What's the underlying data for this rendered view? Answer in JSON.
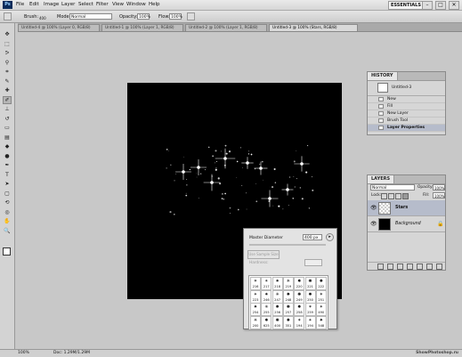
{
  "menubar": {
    "logo": "Ps",
    "items": [
      "File",
      "Edit",
      "Image",
      "Layer",
      "Select",
      "Filter",
      "View",
      "Window",
      "Help"
    ],
    "workspace": "ESSENTIALS ▾",
    "win_buttons": [
      "–",
      "□",
      "✕"
    ]
  },
  "options": {
    "brush_label": "Brush:",
    "brush_size": "400",
    "mode_label": "Mode:",
    "mode_value": "Normal",
    "opacity_label": "Opacity:",
    "opacity_value": "100%",
    "flow_label": "Flow:",
    "flow_value": "100%"
  },
  "tabs": [
    {
      "label": "Untitled-4 @ 100% (Layer 0, RGB/8)"
    },
    {
      "label": "Untitled-1 @ 100% (Layer 1, RGB/8)"
    },
    {
      "label": "Untitled-2 @ 100% (Layer 1, RGB/8)"
    },
    {
      "label": "Untitled-3 @ 100% (Stars, RGB/8)"
    }
  ],
  "tools": [
    {
      "name": "move-tool-icon",
      "glyph": "✥"
    },
    {
      "name": "marquee-tool-icon",
      "glyph": "⬚"
    },
    {
      "name": "lasso-tool-icon",
      "glyph": "ᕗ"
    },
    {
      "name": "quick-select-tool-icon",
      "glyph": "⚲"
    },
    {
      "name": "crop-tool-icon",
      "glyph": "⌗"
    },
    {
      "name": "eyedropper-tool-icon",
      "glyph": "✎"
    },
    {
      "name": "healing-tool-icon",
      "glyph": "✚"
    },
    {
      "name": "brush-tool-icon",
      "glyph": "✐"
    },
    {
      "name": "stamp-tool-icon",
      "glyph": "⊥"
    },
    {
      "name": "history-brush-tool-icon",
      "glyph": "↺"
    },
    {
      "name": "eraser-tool-icon",
      "glyph": "▭"
    },
    {
      "name": "gradient-tool-icon",
      "glyph": "▤"
    },
    {
      "name": "blur-tool-icon",
      "glyph": "◆"
    },
    {
      "name": "dodge-tool-icon",
      "glyph": "●"
    },
    {
      "name": "pen-tool-icon",
      "glyph": "✒"
    },
    {
      "name": "type-tool-icon",
      "glyph": "T"
    },
    {
      "name": "path-select-tool-icon",
      "glyph": "➤"
    },
    {
      "name": "shape-tool-icon",
      "glyph": "▢"
    },
    {
      "name": "3d-rotate-tool-icon",
      "glyph": "⟲"
    },
    {
      "name": "3d-orbit-tool-icon",
      "glyph": "◎"
    },
    {
      "name": "hand-tool-icon",
      "glyph": "✋"
    },
    {
      "name": "zoom-tool-icon",
      "glyph": "🔍"
    }
  ],
  "history": {
    "tab": "HISTORY",
    "snapshot": "Untitled-3",
    "items": [
      "New",
      "Fill",
      "New Layer",
      "Brush Tool",
      "Layer Properties"
    ]
  },
  "layers": {
    "tab": "LAYERS",
    "blend_mode": "Normal",
    "opacity_label": "Opacity:",
    "opacity_value": "100%",
    "lock_label": "Lock:",
    "fill_label": "Fill:",
    "fill_value": "100%",
    "items": [
      {
        "name": "Stars"
      },
      {
        "name": "Background"
      }
    ]
  },
  "brush_popup": {
    "master_label": "Master Diameter",
    "master_value": "400 px",
    "use_sample_label": "Use Sample Size",
    "hardness_label": "Hardness:",
    "sizes": [
      [
        "216",
        "217",
        "218",
        "219",
        "220",
        "221",
        "222"
      ],
      [
        "223",
        "246",
        "247",
        "248",
        "249",
        "250",
        "251"
      ],
      [
        "254",
        "255",
        "256",
        "257",
        "258",
        "259",
        "490"
      ],
      [
        "200",
        "625",
        "400",
        "351",
        "194",
        "194",
        "548"
      ]
    ]
  },
  "status": {
    "zoom": "100%",
    "doc": "Doc: 1.29M/1.29M"
  },
  "watermark": "ShowPhotoshop.ru",
  "colors": {
    "canvas": "#000000",
    "selected_row": "#b6bccb",
    "panel_bg": "#d6d6d6"
  }
}
